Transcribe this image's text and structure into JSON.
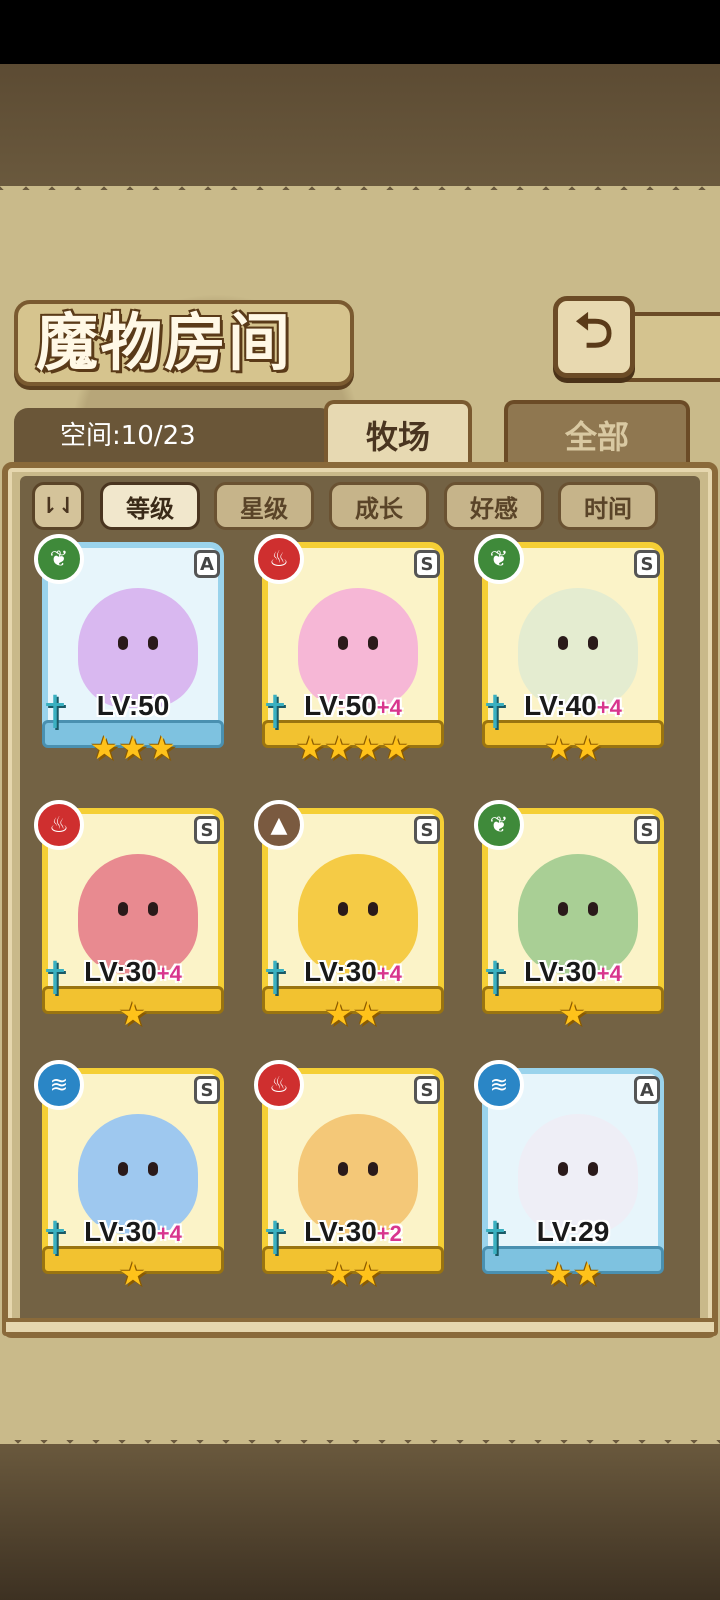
{
  "header": {
    "title": "魔物房间",
    "back_icon": "back-arrow-icon"
  },
  "space": {
    "label": "空间:10/23"
  },
  "tabs": [
    {
      "label": "牧场",
      "active": true
    },
    {
      "label": "全部",
      "active": false
    }
  ],
  "sort": {
    "toggle_icon": "sort-order-icon",
    "toggle_text": "⇂⇃",
    "buttons": [
      {
        "label": "等级",
        "active": true
      },
      {
        "label": "星级",
        "active": false
      },
      {
        "label": "成长",
        "active": false
      },
      {
        "label": "好感",
        "active": false
      },
      {
        "label": "时间",
        "active": false
      }
    ]
  },
  "monsters": [
    {
      "element": "grass",
      "rank": "A",
      "level": "LV:50",
      "bonus": "",
      "stars": 3,
      "color": "#d9b8f0"
    },
    {
      "element": "fire",
      "rank": "S",
      "level": "LV:50",
      "bonus": "+4",
      "stars": 4,
      "color": "#f6b7d6"
    },
    {
      "element": "grass",
      "rank": "S",
      "level": "LV:40",
      "bonus": "+4",
      "stars": 2,
      "color": "#e4ecd0"
    },
    {
      "element": "fire",
      "rank": "S",
      "level": "LV:30",
      "bonus": "+4",
      "stars": 1,
      "color": "#e88a90"
    },
    {
      "element": "earth",
      "rank": "S",
      "level": "LV:30",
      "bonus": "+4",
      "stars": 2,
      "color": "#f5cb45"
    },
    {
      "element": "grass",
      "rank": "S",
      "level": "LV:30",
      "bonus": "+4",
      "stars": 1,
      "color": "#a9cf95"
    },
    {
      "element": "water",
      "rank": "S",
      "level": "LV:30",
      "bonus": "+4",
      "stars": 1,
      "color": "#9ec8ef"
    },
    {
      "element": "fire",
      "rank": "S",
      "level": "LV:30",
      "bonus": "+2",
      "stars": 2,
      "color": "#f4c878"
    },
    {
      "element": "water",
      "rank": "A",
      "level": "LV:29",
      "bonus": "",
      "stars": 2,
      "color": "#eeeef6"
    }
  ],
  "element_glyphs": {
    "grass": "❦",
    "fire": "♨",
    "earth": "▲",
    "water": "≋"
  }
}
